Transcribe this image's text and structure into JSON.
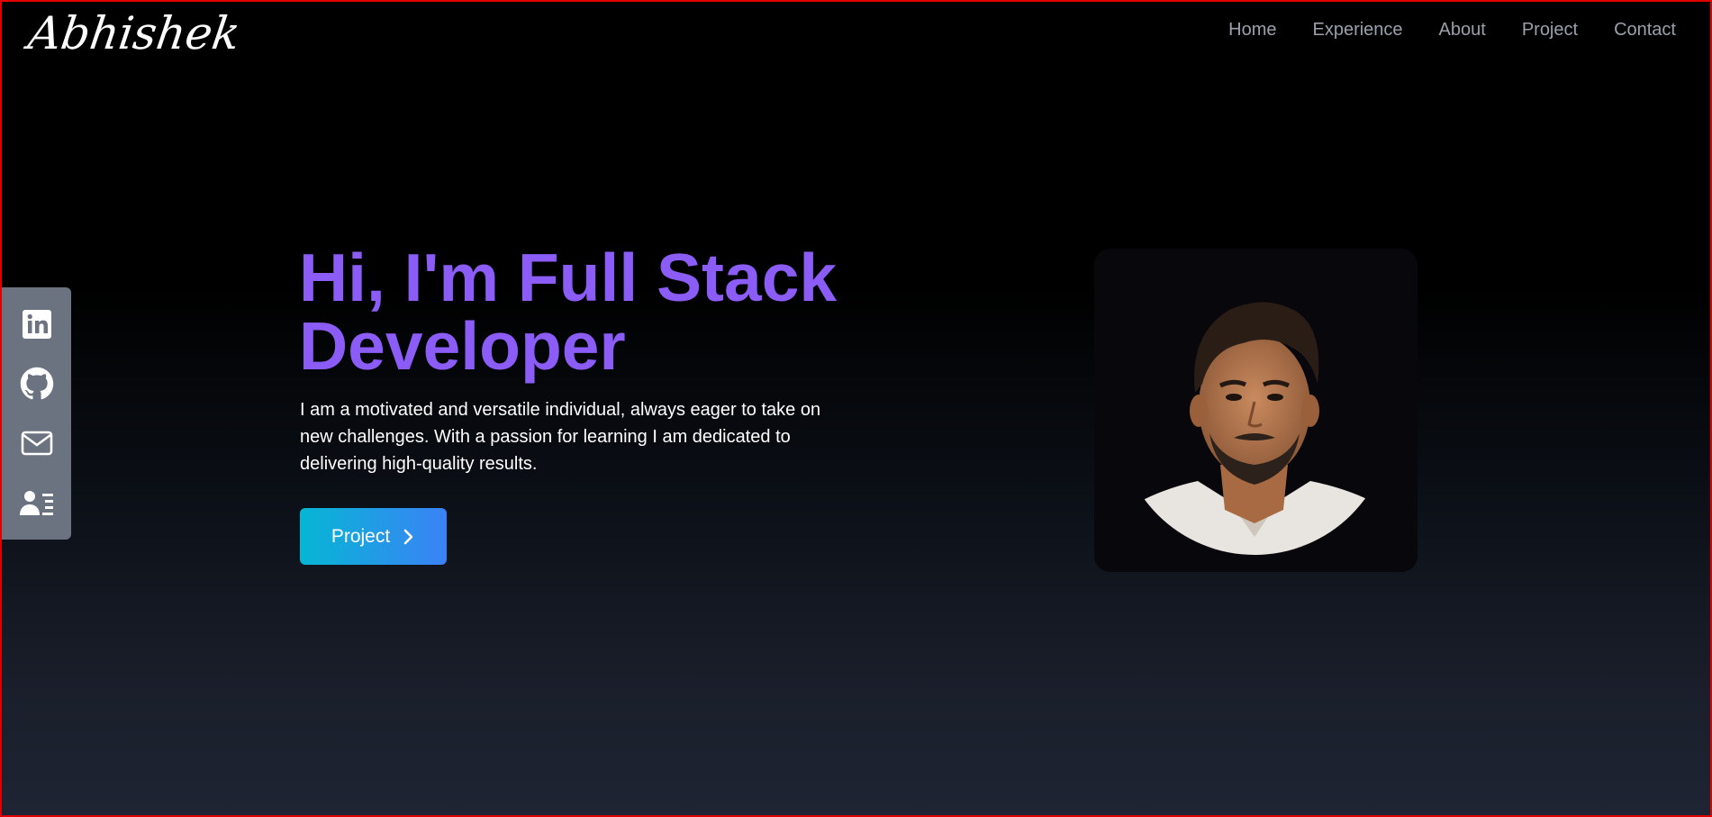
{
  "header": {
    "logo_text": "Abhishek",
    "nav": [
      {
        "label": "Home"
      },
      {
        "label": "Experience"
      },
      {
        "label": "About"
      },
      {
        "label": "Project"
      },
      {
        "label": "Contact"
      }
    ]
  },
  "social": {
    "items": [
      {
        "icon": "linkedin-icon"
      },
      {
        "icon": "github-icon"
      },
      {
        "icon": "mail-icon"
      },
      {
        "icon": "resume-icon"
      }
    ]
  },
  "hero": {
    "title_line1": "Hi, I'm Full Stack",
    "title_line2": "Developer",
    "description": "I am a motivated and versatile individual, always eager to take on new challenges. With a passion for learning I am dedicated to delivering high-quality results.",
    "cta_label": "Project",
    "cta_icon": "chevron-right-icon"
  },
  "profile": {
    "image": "profile-photo"
  },
  "colors": {
    "accent": "#8b5cf6",
    "nav_text": "#9aa0ac",
    "sidebar_bg": "#6b7280",
    "cta_gradient_start": "#06b6d4",
    "cta_gradient_end": "#3b82f6"
  }
}
